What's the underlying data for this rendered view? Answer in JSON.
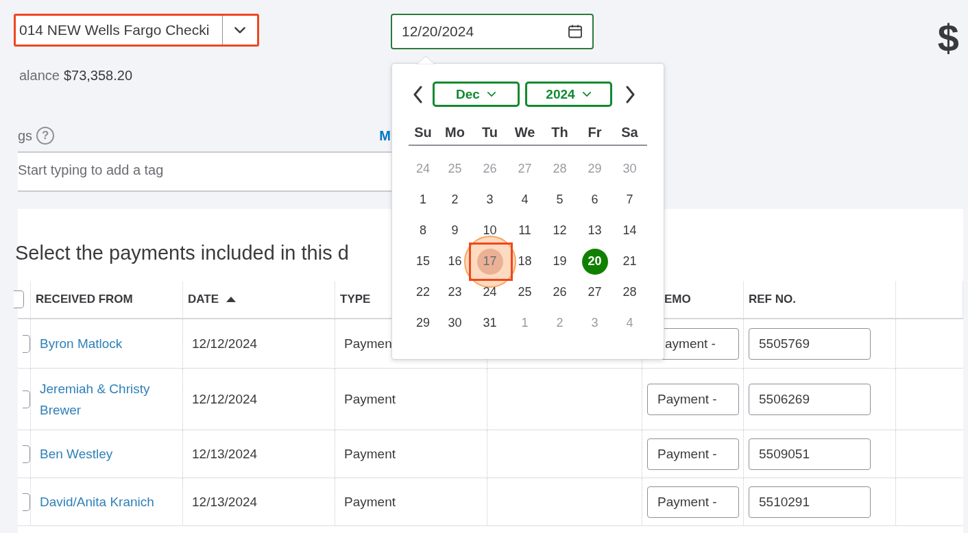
{
  "account_select": {
    "value": "014 NEW Wells Fargo Checki",
    "annotated": true
  },
  "date_field": {
    "value": "12/20/2024"
  },
  "currency_symbol": "$",
  "balance": {
    "label": "alance",
    "amount": "$73,358.20"
  },
  "tags": {
    "label": "gs",
    "help_icon": "?",
    "link": "M",
    "placeholder": "Start typing to add a tag"
  },
  "payments": {
    "heading": "Select the payments included in this d",
    "select_all": {
      "checked": false
    },
    "columns": [
      {
        "kind": "text",
        "label": "RECEIVED FROM"
      },
      {
        "kind": "text",
        "label": "DATE",
        "sorted": true
      },
      {
        "kind": "text",
        "label": "TYPE"
      },
      {
        "kind": "blank"
      },
      {
        "kind": "text",
        "label": "EMO",
        "clipped": true
      },
      {
        "kind": "text",
        "label": "REF NO."
      },
      {
        "kind": "blank"
      }
    ],
    "rows": [
      {
        "checked": false,
        "received_from": "Byron Matlock",
        "date": "12/12/2024",
        "type": "Paymen",
        "memo": "ayment -",
        "memo_clipped": true,
        "ref_no": "5505769"
      },
      {
        "checked": false,
        "received_from": "Jeremiah & Christy Brewer",
        "date": "12/12/2024",
        "type": "Payment",
        "memo": "Payment -",
        "memo_clipped": false,
        "ref_no": "5506269"
      },
      {
        "checked": false,
        "received_from": "Ben Westley",
        "date": "12/13/2024",
        "type": "Payment",
        "memo": "Payment -",
        "memo_clipped": false,
        "ref_no": "5509051"
      },
      {
        "checked": false,
        "received_from": "David/Anita Kranich",
        "date": "12/13/2024",
        "type": "Payment",
        "memo": "Payment -",
        "memo_clipped": false,
        "ref_no": "5510291"
      }
    ]
  },
  "calendar": {
    "month": "Dec",
    "year": "2024",
    "weekdays": [
      "Su",
      "Mo",
      "Tu",
      "We",
      "Th",
      "Fr",
      "Sa"
    ],
    "days": [
      {
        "label": "24",
        "outside": true,
        "selected": false,
        "highlighted": false
      },
      {
        "label": "25",
        "outside": true,
        "selected": false,
        "highlighted": false
      },
      {
        "label": "26",
        "outside": true,
        "selected": false,
        "highlighted": false
      },
      {
        "label": "27",
        "outside": true,
        "selected": false,
        "highlighted": false
      },
      {
        "label": "28",
        "outside": true,
        "selected": false,
        "highlighted": false
      },
      {
        "label": "29",
        "outside": true,
        "selected": false,
        "highlighted": false
      },
      {
        "label": "30",
        "outside": true,
        "selected": false,
        "highlighted": false
      },
      {
        "label": "1",
        "outside": false,
        "selected": false,
        "highlighted": false
      },
      {
        "label": "2",
        "outside": false,
        "selected": false,
        "highlighted": false
      },
      {
        "label": "3",
        "outside": false,
        "selected": false,
        "highlighted": false
      },
      {
        "label": "4",
        "outside": false,
        "selected": false,
        "highlighted": false
      },
      {
        "label": "5",
        "outside": false,
        "selected": false,
        "highlighted": false
      },
      {
        "label": "6",
        "outside": false,
        "selected": false,
        "highlighted": false
      },
      {
        "label": "7",
        "outside": false,
        "selected": false,
        "highlighted": false
      },
      {
        "label": "8",
        "outside": false,
        "selected": false,
        "highlighted": false
      },
      {
        "label": "9",
        "outside": false,
        "selected": false,
        "highlighted": false
      },
      {
        "label": "10",
        "outside": false,
        "selected": false,
        "highlighted": false
      },
      {
        "label": "11",
        "outside": false,
        "selected": false,
        "highlighted": false
      },
      {
        "label": "12",
        "outside": false,
        "selected": false,
        "highlighted": false
      },
      {
        "label": "13",
        "outside": false,
        "selected": false,
        "highlighted": false
      },
      {
        "label": "14",
        "outside": false,
        "selected": false,
        "highlighted": false
      },
      {
        "label": "15",
        "outside": false,
        "selected": false,
        "highlighted": false
      },
      {
        "label": "16",
        "outside": false,
        "selected": false,
        "highlighted": false
      },
      {
        "label": "17",
        "outside": false,
        "selected": false,
        "highlighted": true
      },
      {
        "label": "18",
        "outside": false,
        "selected": false,
        "highlighted": false
      },
      {
        "label": "19",
        "outside": false,
        "selected": false,
        "highlighted": false
      },
      {
        "label": "20",
        "outside": false,
        "selected": true,
        "highlighted": false
      },
      {
        "label": "21",
        "outside": false,
        "selected": false,
        "highlighted": false
      },
      {
        "label": "22",
        "outside": false,
        "selected": false,
        "highlighted": false
      },
      {
        "label": "23",
        "outside": false,
        "selected": false,
        "highlighted": false
      },
      {
        "label": "24",
        "outside": false,
        "selected": false,
        "highlighted": false
      },
      {
        "label": "25",
        "outside": false,
        "selected": false,
        "highlighted": false
      },
      {
        "label": "26",
        "outside": false,
        "selected": false,
        "highlighted": false
      },
      {
        "label": "27",
        "outside": false,
        "selected": false,
        "highlighted": false
      },
      {
        "label": "28",
        "outside": false,
        "selected": false,
        "highlighted": false
      },
      {
        "label": "29",
        "outside": false,
        "selected": false,
        "highlighted": false
      },
      {
        "label": "30",
        "outside": false,
        "selected": false,
        "highlighted": false
      },
      {
        "label": "31",
        "outside": false,
        "selected": false,
        "highlighted": false
      },
      {
        "label": "1",
        "outside": true,
        "selected": false,
        "highlighted": false
      },
      {
        "label": "2",
        "outside": true,
        "selected": false,
        "highlighted": false
      },
      {
        "label": "3",
        "outside": true,
        "selected": false,
        "highlighted": false
      },
      {
        "label": "4",
        "outside": true,
        "selected": false,
        "highlighted": false
      }
    ]
  }
}
